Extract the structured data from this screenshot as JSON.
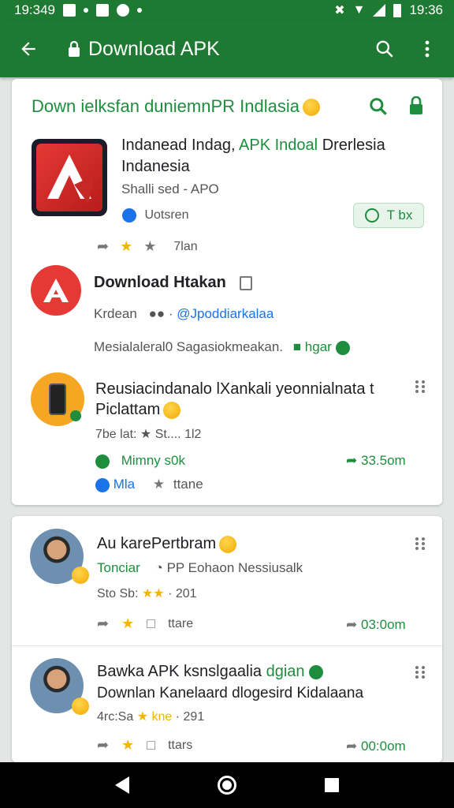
{
  "status_bar": {
    "time_left": "19:349",
    "time_right": "19:36"
  },
  "app_bar": {
    "title": "Download APK"
  },
  "card1": {
    "header": "Down ielksfan duniemnPR Indlasia",
    "featured": {
      "title_line1_a": "Indanead Indag,",
      "title_line1_b": "APK Indoal",
      "title_line1_c": "Drerlesia",
      "title_line2": "Indanesia",
      "meta": "Shalli sed - APO",
      "verified_label": "Uotsren",
      "action_label": "T bx",
      "stat": "7lan"
    },
    "download_item": {
      "title": "Download Htakan",
      "author_prefix": "Krdean",
      "author_handle": "@Jpoddiarkalaa",
      "desc": "Mesialaleral0 Sagasiokmeakan.",
      "desc_link": "hgar"
    },
    "phone_item": {
      "title_line1": "Reusiacindanalo lXankali yeonnialnata t",
      "title_line2": "Piclattam",
      "meta": "7be lat: ★ St.... 1l2",
      "green_label": "Mimny s0k",
      "size": "33.5om",
      "blue_label": "Mla",
      "share_label": "ttane"
    }
  },
  "card2": {
    "items": [
      {
        "title": "Au karePertbram",
        "sub_green": "Tonciar",
        "sub_grey": "PP Eohaon Nessiusalk",
        "meta": "Sto Sb:",
        "rating_text": "· 201",
        "share": "ttare",
        "time": "03:0om"
      },
      {
        "title": "Bawka APK ksnslgaalia",
        "title_green": "dgian",
        "line2": "Downlan Kanelaard dlogesird Kidalaana",
        "meta": "4rc:Sa",
        "meta_gold": "★ kne",
        "rating_text": "· 291",
        "share": "ttars",
        "time": "00:0om"
      }
    ]
  }
}
